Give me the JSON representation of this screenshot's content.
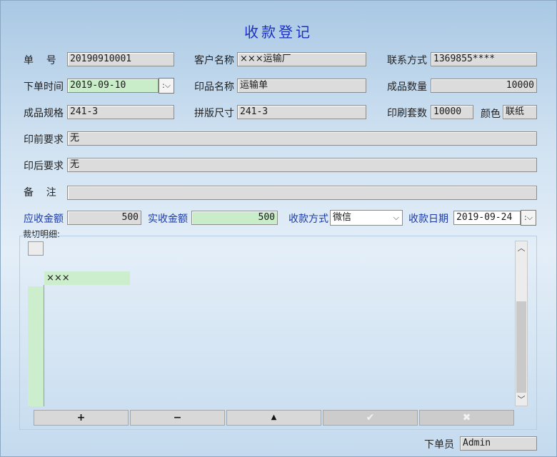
{
  "title": "收款登记",
  "fields": {
    "order_no": {
      "label": "单    号",
      "value": "20190910001"
    },
    "customer": {
      "label": "客户名称",
      "value": "×××运输厂"
    },
    "contact": {
      "label": "联系方式",
      "value": "1369855****"
    },
    "order_time": {
      "label": "下单时间",
      "value": "2019-09-10",
      "spin": ":"
    },
    "print_name": {
      "label": "印品名称",
      "value": "运输单"
    },
    "quantity": {
      "label": "成品数量",
      "value": "10000"
    },
    "spec": {
      "label": "成品规格",
      "value": "241-3"
    },
    "plate_size": {
      "label": "拼版尺寸",
      "value": "241-3"
    },
    "print_sets": {
      "label": "印刷套数",
      "value": "10000"
    },
    "color": {
      "label": "颜色",
      "value": "联纸"
    },
    "pre_press": {
      "label": "印前要求",
      "value": "无"
    },
    "post_press": {
      "label": "印后要求",
      "value": "无"
    },
    "remark": {
      "label": "备    注",
      "value": ""
    }
  },
  "payment": {
    "receivable": {
      "label": "应收金额",
      "value": "500"
    },
    "received": {
      "label": "实收金额",
      "value": "500"
    },
    "method": {
      "label": "收款方式",
      "value": "微信"
    },
    "date": {
      "label": "收款日期",
      "value": "2019-09-24",
      "spin": ":"
    }
  },
  "detail": {
    "label": "裁切明细:",
    "cell": "×××"
  },
  "toolbar": {
    "add": "+",
    "remove": "−",
    "up": "▲",
    "confirm": "✔",
    "cancel": "✖"
  },
  "footer": {
    "label": "下单员",
    "value": "Admin"
  },
  "colors": {
    "title": "#1b2fc4",
    "accent_label": "#1b3aa8",
    "green_field": "#c9ecc9"
  }
}
